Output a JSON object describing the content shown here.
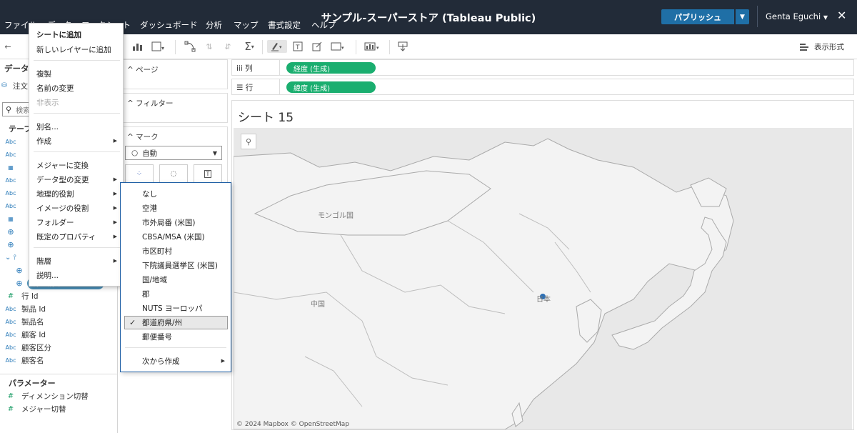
{
  "topbar": {
    "menu": [
      "ファイル",
      "データ",
      "ワークシート",
      "ダッシュボード",
      "分析",
      "マップ",
      "書式設定",
      "ヘルプ"
    ],
    "app_title": "サンプル-スーパーストア (Tableau Public)",
    "publish_label": "パブリッシュ",
    "user_name": "Genta Eguchi",
    "close_icon": "close-icon"
  },
  "toolbar": {
    "show_me_label": "表示形式"
  },
  "data_pane": {
    "header_label": "データ",
    "datasource_label": "注文",
    "search_placeholder": "検索",
    "tables_header": "テーブル",
    "fields": [
      {
        "type": "Abc",
        "name": ""
      },
      {
        "type": "Abc",
        "name": ""
      },
      {
        "type": "date",
        "name": ""
      },
      {
        "type": "Abc",
        "name": ""
      },
      {
        "type": "Abc",
        "name": ""
      },
      {
        "type": "Abc",
        "name": ""
      },
      {
        "type": "date",
        "name": ""
      },
      {
        "type": "globe",
        "name": ""
      },
      {
        "type": "globe",
        "name": ""
      },
      {
        "type": "hierarchy",
        "name": ""
      },
      {
        "type": "globe",
        "name": ""
      },
      {
        "type": "globe",
        "name": "都道府県"
      },
      {
        "type": "#",
        "name": "行 Id"
      },
      {
        "type": "Abc",
        "name": "製品 Id"
      },
      {
        "type": "Abc",
        "name": "製品名"
      },
      {
        "type": "Abc",
        "name": "顧客 Id"
      },
      {
        "type": "Abc",
        "name": "顧客区分"
      },
      {
        "type": "Abc",
        "name": "顧客名"
      }
    ],
    "parameters_header": "パラメーター",
    "parameters": [
      "ディメンション切替",
      "メジャー切替"
    ]
  },
  "cards": {
    "pages_label": "ページ",
    "filters_label": "フィルター",
    "marks_label": "マーク",
    "marks_type": "自動"
  },
  "shelves": {
    "columns_label": "列",
    "rows_label": "行",
    "columns_pill": "経度 (生成)",
    "rows_pill": "緯度 (生成)"
  },
  "view": {
    "sheet_title": "シート 15",
    "map_labels": {
      "mongolia": "モンゴル国",
      "china": "中国",
      "japan": "日本"
    },
    "attribution": "© 2024 Mapbox  © OpenStreetMap"
  },
  "context_menu": {
    "items": [
      {
        "label": "シートに追加",
        "bold": true
      },
      {
        "label": "新しいレイヤーに追加"
      },
      {
        "label": "複製"
      },
      {
        "label": "名前の変更"
      },
      {
        "label": "非表示",
        "disabled": true
      },
      {
        "label": "別名..."
      },
      {
        "label": "作成",
        "submenu": true
      },
      {
        "label": "メジャーに変換"
      },
      {
        "label": "データ型の変更",
        "submenu": true
      },
      {
        "label": "地理的役割",
        "submenu": true
      },
      {
        "label": "イメージの役割",
        "submenu": true
      },
      {
        "label": "フォルダー",
        "submenu": true
      },
      {
        "label": "既定のプロパティ",
        "submenu": true
      },
      {
        "label": "階層",
        "submenu": true
      },
      {
        "label": "説明..."
      }
    ]
  },
  "geo_submenu": {
    "items": [
      "なし",
      "空港",
      "市外局番 (米国)",
      "CBSA/MSA (米国)",
      "市区町村",
      "下院議員選挙区 (米国)",
      "国/地域",
      "郡",
      "NUTS ヨーロッパ",
      "都道府県/州",
      "郵便番号"
    ],
    "selected": "都道府県/州",
    "create_from": "次から作成"
  },
  "colors": {
    "topbar": "#222b38",
    "publish": "#1f6fa6",
    "pill": "#1aae6f",
    "highlight": "#4a90b8",
    "submenu_border": "#1f5fa5"
  }
}
